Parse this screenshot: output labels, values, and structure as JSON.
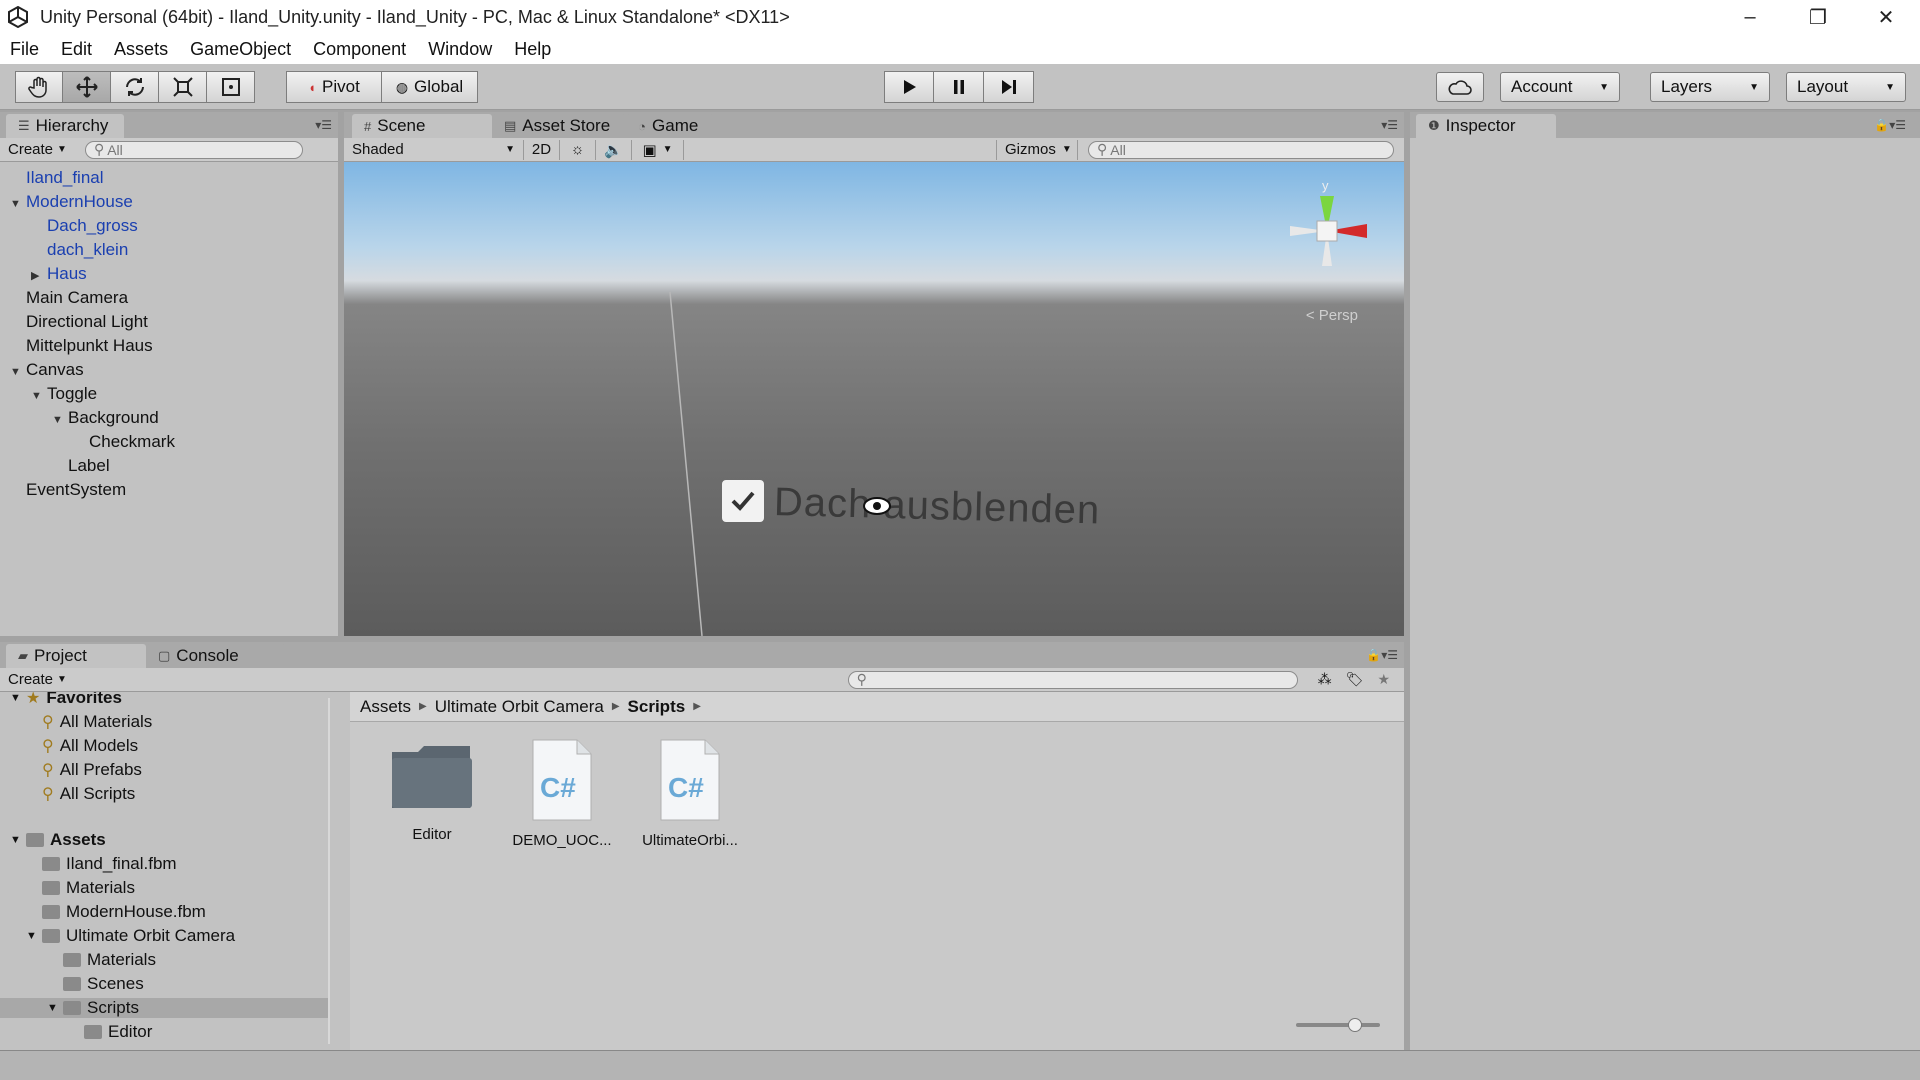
{
  "window": {
    "title": "Unity Personal (64bit) - Iland_Unity.unity - Iland_Unity - PC, Mac & Linux Standalone* <DX11>",
    "minimize": "–",
    "maximize": "❐",
    "close": "✕"
  },
  "menu": [
    "File",
    "Edit",
    "Assets",
    "GameObject",
    "Component",
    "Window",
    "Help"
  ],
  "toolbar": {
    "pivot": "Pivot",
    "global": "Global",
    "account": "Account",
    "layers": "Layers",
    "layout": "Layout"
  },
  "hierarchy": {
    "tab": "Hierarchy",
    "create": "Create",
    "search_placeholder": "All",
    "items": [
      {
        "label": "Iland_final",
        "depth": 0,
        "expand": "",
        "blue": true
      },
      {
        "label": "ModernHouse",
        "depth": 0,
        "expand": "▼",
        "blue": true
      },
      {
        "label": "Dach_gross",
        "depth": 1,
        "expand": "",
        "blue": true
      },
      {
        "label": "dach_klein",
        "depth": 1,
        "expand": "",
        "blue": true
      },
      {
        "label": "Haus",
        "depth": 1,
        "expand": "▶",
        "blue": true
      },
      {
        "label": "Main Camera",
        "depth": 0,
        "expand": "",
        "blue": false
      },
      {
        "label": "Directional Light",
        "depth": 0,
        "expand": "",
        "blue": false
      },
      {
        "label": "Mittelpunkt Haus",
        "depth": 0,
        "expand": "",
        "blue": false
      },
      {
        "label": "Canvas",
        "depth": 0,
        "expand": "▼",
        "blue": false
      },
      {
        "label": "Toggle",
        "depth": 1,
        "expand": "▼",
        "blue": false
      },
      {
        "label": "Background",
        "depth": 2,
        "expand": "▼",
        "blue": false
      },
      {
        "label": "Checkmark",
        "depth": 3,
        "expand": "",
        "blue": false
      },
      {
        "label": "Label",
        "depth": 2,
        "expand": "",
        "blue": false
      },
      {
        "label": "EventSystem",
        "depth": 0,
        "expand": "",
        "blue": false
      }
    ]
  },
  "scene": {
    "tabs": [
      "Scene",
      "Asset Store",
      "Game"
    ],
    "shading": "Shaded",
    "mode_2d": "2D",
    "gizmos": "Gizmos",
    "search_placeholder": "All",
    "toggle_label": "Dach ausblenden",
    "persp": "< Persp",
    "axis_y": "y"
  },
  "inspector": {
    "tab": "Inspector"
  },
  "project": {
    "tabs": [
      "Project",
      "Console"
    ],
    "create": "Create",
    "favorites_header": "Favorites",
    "favorites": [
      "All Materials",
      "All Models",
      "All Prefabs",
      "All Scripts"
    ],
    "assets_header": "Assets",
    "assets": [
      {
        "label": "Iland_final.fbm",
        "depth": 1,
        "expand": ""
      },
      {
        "label": "Materials",
        "depth": 1,
        "expand": ""
      },
      {
        "label": "ModernHouse.fbm",
        "depth": 1,
        "expand": ""
      },
      {
        "label": "Ultimate Orbit Camera",
        "depth": 1,
        "expand": "▼"
      },
      {
        "label": "Materials",
        "depth": 2,
        "expand": ""
      },
      {
        "label": "Scenes",
        "depth": 2,
        "expand": ""
      },
      {
        "label": "Scripts",
        "depth": 2,
        "expand": "▼"
      },
      {
        "label": "Editor",
        "depth": 3,
        "expand": ""
      }
    ],
    "breadcrumb": [
      "Assets",
      "Ultimate Orbit Camera",
      "Scripts"
    ],
    "files": [
      {
        "label": "Editor",
        "kind": "folder"
      },
      {
        "label": "DEMO_UOC...",
        "kind": "cs"
      },
      {
        "label": "UltimateOrbi...",
        "kind": "cs"
      }
    ],
    "cs_glyph": "C#"
  }
}
